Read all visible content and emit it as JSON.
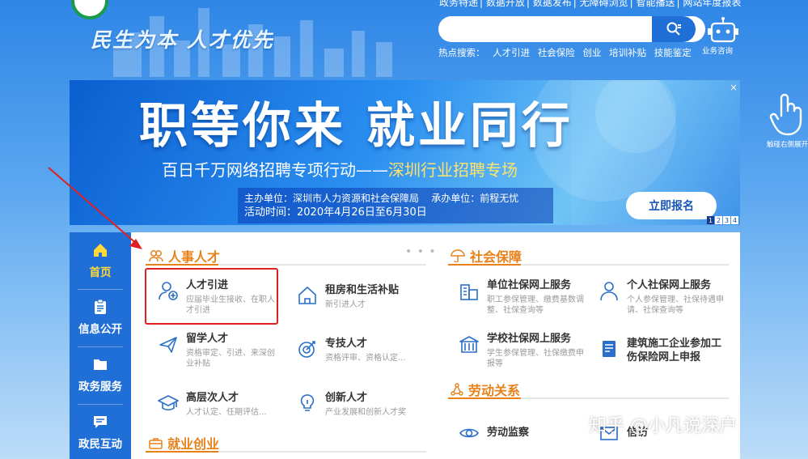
{
  "header": {
    "slogan": "民生为本 人才优先",
    "top_links": [
      "政务特递",
      "数据开放",
      "数据发布",
      "无障碍浏览",
      "智能播送",
      "网站年度报表"
    ],
    "search": {
      "placeholder": ""
    },
    "hot_label": "热点搜索：",
    "hot_items": [
      "人才引进",
      "社会保险",
      "创业",
      "培训补贴",
      "技能鉴定"
    ],
    "robot_label": "业务咨询"
  },
  "banner": {
    "headline": "职等你来 就业同行",
    "sub_left": "百日千万网络招聘专项行动——",
    "sub_right": "深圳行业招聘专场",
    "organizer": "主办单位：深圳市人力资源和社会保障局",
    "co_organizer": "承办单位：前程无忧",
    "time": "活动时间：2020年4月26日至6月30日",
    "button": "立即报名",
    "close": "×",
    "pages": [
      "1",
      "2",
      "3",
      "4"
    ],
    "active_page": 1
  },
  "side_hint": "触碰右侧展开",
  "sidenav": [
    {
      "label": "首页",
      "icon": "home-icon",
      "active": true
    },
    {
      "label": "信息公开",
      "icon": "clipboard-icon",
      "active": false
    },
    {
      "label": "政务服务",
      "icon": "folder-icon",
      "active": false
    },
    {
      "label": "政民互动",
      "icon": "chat-icon",
      "active": false
    }
  ],
  "sections": {
    "talent": {
      "title": "人事人才",
      "more": "• • •",
      "items": [
        {
          "title": "人才引进",
          "desc": "应届毕业生接收、在职人才引进",
          "icon": "person-add-icon"
        },
        {
          "title": "租房和生活补贴",
          "desc": "新引进人才",
          "icon": "house-icon"
        },
        {
          "title": "留学人才",
          "desc": "资格审定、引进、来深创业补贴",
          "icon": "plane-icon"
        },
        {
          "title": "专技人才",
          "desc": "资格评审、资格认定...",
          "icon": "target-icon"
        },
        {
          "title": "高层次人才",
          "desc": "人才认定、任期评估...",
          "icon": "graduation-cap-icon"
        },
        {
          "title": "创新人才",
          "desc": "产业发展和创新人才奖",
          "icon": "lightbulb-icon"
        }
      ]
    },
    "social": {
      "title": "社会保障",
      "items": [
        {
          "title": "单位社保网上服务",
          "desc": "职工参保管理、缴费基数调整、社保查询等",
          "icon": "building-icon"
        },
        {
          "title": "个人社保网上服务",
          "desc": "个人参保管理、社保待遇申请、社保查询等",
          "icon": "person-icon"
        },
        {
          "title": "学校社保网上服务",
          "desc": "学生参保管理、社保缴费申报等",
          "icon": "school-icon"
        },
        {
          "title": "建筑施工企业参加工伤保险网上申报",
          "desc": "",
          "icon": "document-icon"
        }
      ]
    },
    "labor": {
      "title": "劳动关系",
      "items": [
        {
          "title": "劳动监察",
          "icon": "eye-icon"
        },
        {
          "title": "信访",
          "icon": "letter-icon"
        }
      ]
    },
    "employment": {
      "title": "就业创业"
    }
  },
  "watermark": "知乎 @小凡说深户",
  "colors": {
    "accent": "#e8811a",
    "nav": "#1f6fd6",
    "highlight_box": "#e02020",
    "icon_blue": "#2a6fc9"
  }
}
